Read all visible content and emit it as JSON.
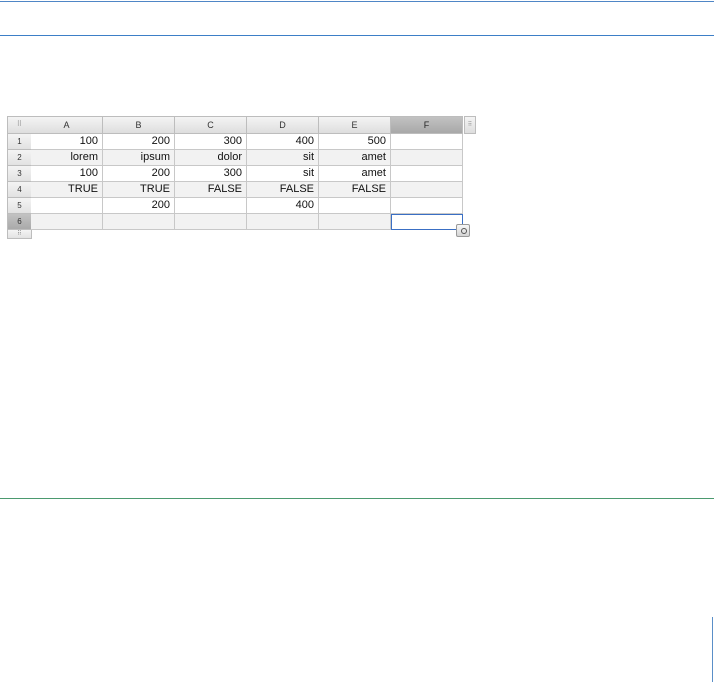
{
  "grid": {
    "corner_glyph": "⠿",
    "grip_glyph": "⠿",
    "columns": [
      "A",
      "B",
      "C",
      "D",
      "E",
      "F"
    ],
    "selected_column": "F",
    "rows": [
      "1",
      "2",
      "3",
      "4",
      "5",
      "6"
    ],
    "selected_row": "6",
    "cells": [
      [
        "100",
        "200",
        "300",
        "400",
        "500",
        ""
      ],
      [
        "lorem",
        "ipsum",
        "dolor",
        "sit",
        "amet",
        ""
      ],
      [
        "100",
        "200",
        "300",
        "sit",
        "amet",
        ""
      ],
      [
        "TRUE",
        "TRUE",
        "FALSE",
        "FALSE",
        "FALSE",
        ""
      ],
      [
        "",
        "200",
        "",
        "400",
        "",
        ""
      ],
      [
        "",
        "",
        "",
        "",
        "",
        ""
      ]
    ],
    "active_cell": "F6",
    "colors": {
      "selection_border": "#3a6fc4",
      "top_rule": "#3d7fc7",
      "bottom_rule": "#4b9a6f"
    }
  }
}
